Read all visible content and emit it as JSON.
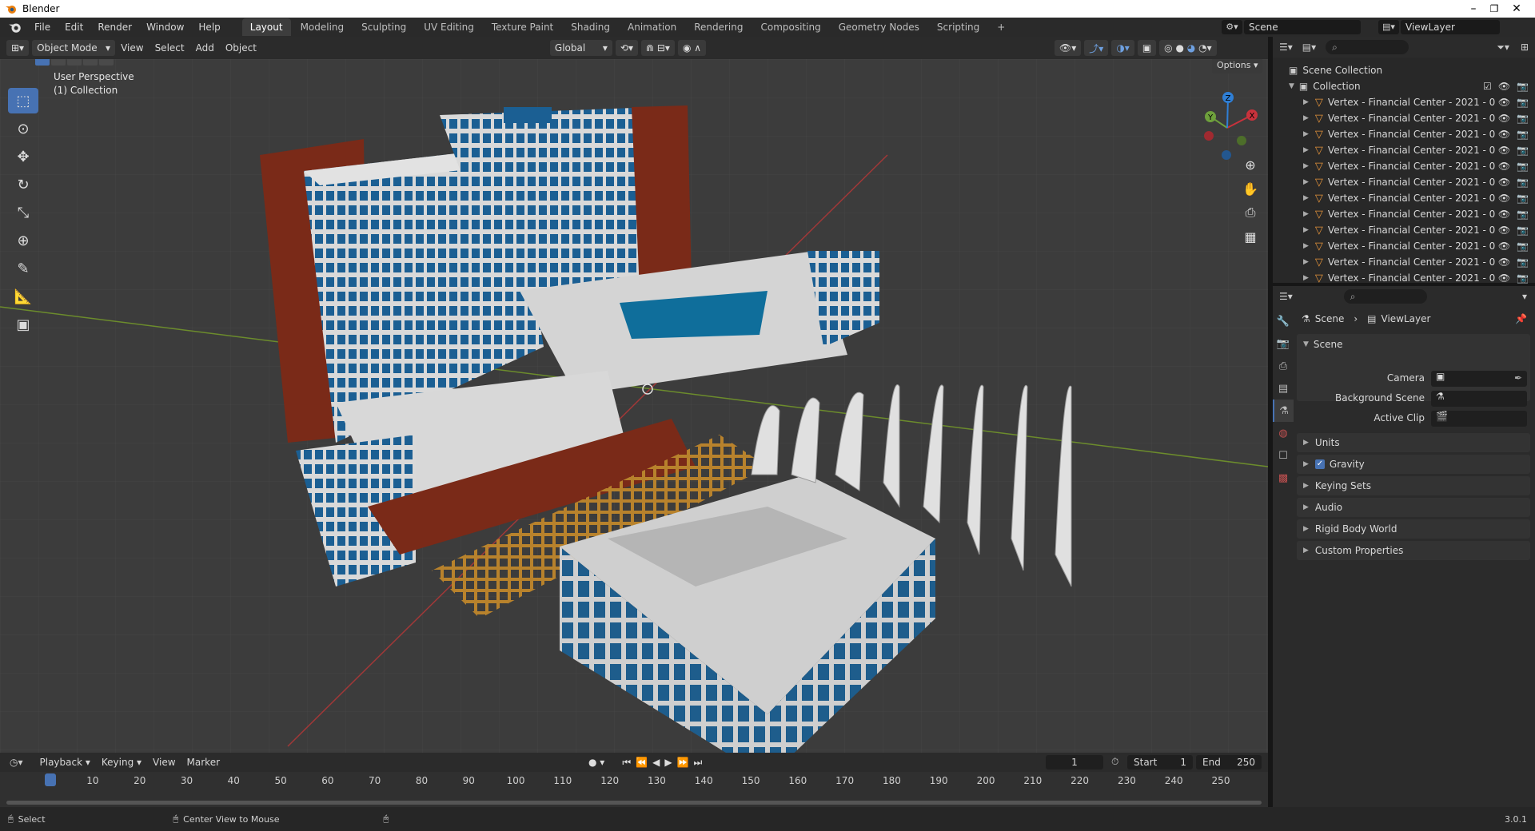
{
  "window": {
    "title": "Blender",
    "minimize": "–",
    "maximize": "❐",
    "close": "✕"
  },
  "menu": [
    "File",
    "Edit",
    "Render",
    "Window",
    "Help"
  ],
  "workspaces": [
    "Layout",
    "Modeling",
    "Sculpting",
    "UV Editing",
    "Texture Paint",
    "Shading",
    "Animation",
    "Rendering",
    "Compositing",
    "Geometry Nodes",
    "Scripting",
    "+"
  ],
  "active_workspace": "Layout",
  "scene_name": "Scene",
  "view_layer_name": "ViewLayer",
  "viewport_header": {
    "mode": "Object Mode",
    "menus": [
      "View",
      "Select",
      "Add",
      "Object"
    ],
    "transform_orientation": "Global",
    "options_label": "Options"
  },
  "viewport": {
    "perspective": "User Perspective",
    "collection": "(1) Collection",
    "gizmo_axes": {
      "x": "X",
      "y": "Y",
      "z": "Z"
    }
  },
  "outliner": {
    "root": "Scene Collection",
    "collection": "Collection",
    "items": [
      "Vertex - Financial Center - 2021 - 0",
      "Vertex - Financial Center - 2021 - 0",
      "Vertex - Financial Center - 2021 - 0",
      "Vertex - Financial Center - 2021 - 0",
      "Vertex - Financial Center - 2021 - 0",
      "Vertex - Financial Center - 2021 - 0",
      "Vertex - Financial Center - 2021 - 0",
      "Vertex - Financial Center - 2021 - 0",
      "Vertex - Financial Center - 2021 - 0",
      "Vertex - Financial Center - 2021 - 0",
      "Vertex - Financial Center - 2021 - 0",
      "Vertex - Financial Center - 2021 - 0"
    ]
  },
  "properties": {
    "breadcrumb_scene": "Scene",
    "breadcrumb_viewlayer": "ViewLayer",
    "panel_title": "Scene",
    "camera_label": "Camera",
    "background_scene_label": "Background Scene",
    "active_clip_label": "Active Clip",
    "sections": [
      "Units",
      "Gravity",
      "Keying Sets",
      "Audio",
      "Rigid Body World",
      "Custom Properties"
    ],
    "gravity_checked": true
  },
  "timeline": {
    "menus": [
      "Playback",
      "Keying",
      "View",
      "Marker"
    ],
    "current_frame": "1",
    "start_label": "Start",
    "start": "1",
    "end_label": "End",
    "end": "250",
    "ticks": [
      "1",
      "10",
      "20",
      "30",
      "40",
      "50",
      "60",
      "70",
      "80",
      "90",
      "100",
      "110",
      "120",
      "130",
      "140",
      "150",
      "160",
      "170",
      "180",
      "190",
      "200",
      "210",
      "220",
      "230",
      "240",
      "250"
    ]
  },
  "status": {
    "select": "Select",
    "center_view": "Center View to Mouse",
    "version": "3.0.1"
  },
  "colors": {
    "accent": "#4772b3",
    "x_axis": "#c8323c",
    "y_axis": "#6ea03c",
    "z_axis": "#2f7fd6"
  }
}
